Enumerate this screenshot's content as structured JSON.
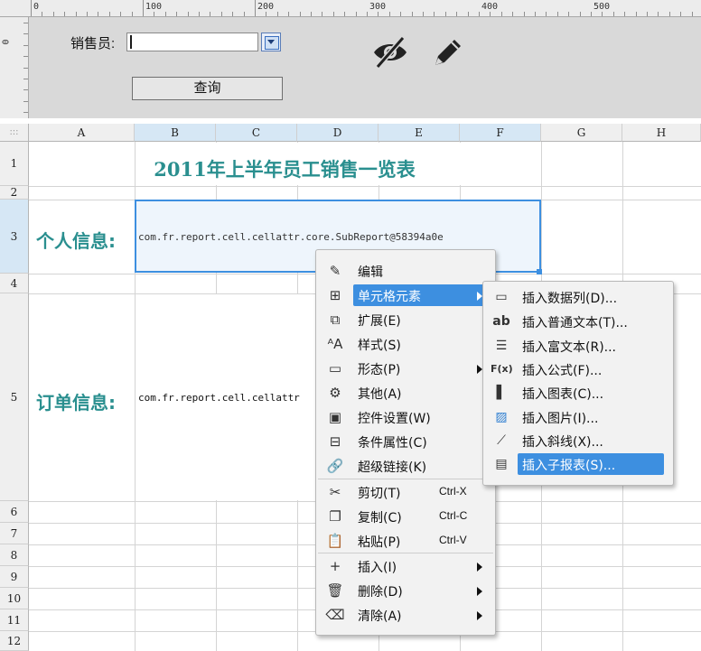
{
  "ruler": {
    "marks": [
      "0",
      "100",
      "200",
      "300",
      "400",
      "500"
    ],
    "vertical_mark": "0"
  },
  "params": {
    "salesperson_label": "销售员:",
    "salesperson_value": "",
    "query_button": "查询",
    "toolbar_icons": [
      "eye-off-icon",
      "pencil-icon"
    ]
  },
  "sheet": {
    "columns": [
      "A",
      "B",
      "C",
      "D",
      "E",
      "F",
      "G",
      "H"
    ],
    "selected_columns": [
      "B",
      "C",
      "D",
      "E",
      "F"
    ],
    "rows": [
      "1",
      "2",
      "3",
      "4",
      "5",
      "6",
      "7",
      "8",
      "9",
      "10",
      "11",
      "12"
    ],
    "selected_row": "3",
    "title": "2011年上半年员工销售一览表",
    "personal_label": "个人信息:",
    "order_label": "订单信息:",
    "b3_value": "com.fr.report.cell.cellattr.core.SubReport@58394a0e",
    "b5_value": "com.fr.report.cell.cellattr"
  },
  "context_menu": {
    "items": [
      {
        "label": "编辑",
        "icon": "pencil-icon"
      },
      {
        "label": "单元格元素",
        "icon": "cell-element-icon",
        "submenu": true,
        "highlighted": true
      },
      {
        "label": "扩展(E)",
        "icon": "expand-icon"
      },
      {
        "label": "样式(S)",
        "icon": "style-icon"
      },
      {
        "label": "形态(P)",
        "icon": "form-icon",
        "submenu": true
      },
      {
        "label": "其他(A)",
        "icon": "gear-icon"
      },
      {
        "label": "控件设置(W)",
        "icon": "widget-icon"
      },
      {
        "label": "条件属性(C)",
        "icon": "condition-icon"
      },
      {
        "label": "超级链接(K)",
        "icon": "link-icon"
      },
      {
        "label": "剪切(T)",
        "icon": "scissors-icon",
        "shortcut": "Ctrl-X"
      },
      {
        "label": "复制(C)",
        "icon": "copy-icon",
        "shortcut": "Ctrl-C"
      },
      {
        "label": "粘贴(P)",
        "icon": "paste-icon",
        "shortcut": "Ctrl-V"
      },
      {
        "label": "插入(I)",
        "icon": "plus-icon",
        "submenu": true
      },
      {
        "label": "删除(D)",
        "icon": "trash-icon",
        "submenu": true
      },
      {
        "label": "清除(A)",
        "icon": "broom-icon",
        "submenu": true
      }
    ]
  },
  "submenu": {
    "items": [
      {
        "label": "插入数据列(D)...",
        "icon": "data-column-icon"
      },
      {
        "label": "插入普通文本(T)...",
        "icon": "text-icon",
        "icon_text": "ab"
      },
      {
        "label": "插入富文本(R)...",
        "icon": "rich-text-icon"
      },
      {
        "label": "插入公式(F)...",
        "icon": "formula-icon",
        "icon_text": "F(x)"
      },
      {
        "label": "插入图表(C)...",
        "icon": "chart-icon"
      },
      {
        "label": "插入图片(I)...",
        "icon": "image-icon"
      },
      {
        "label": "插入斜线(X)...",
        "icon": "slash-icon"
      },
      {
        "label": "插入子报表(S)...",
        "icon": "subreport-icon",
        "highlighted": true
      }
    ]
  },
  "colors": {
    "accent": "#3d8fe0",
    "title_teal": "#2a8f8f",
    "header_selected": "#d6e7f5"
  }
}
